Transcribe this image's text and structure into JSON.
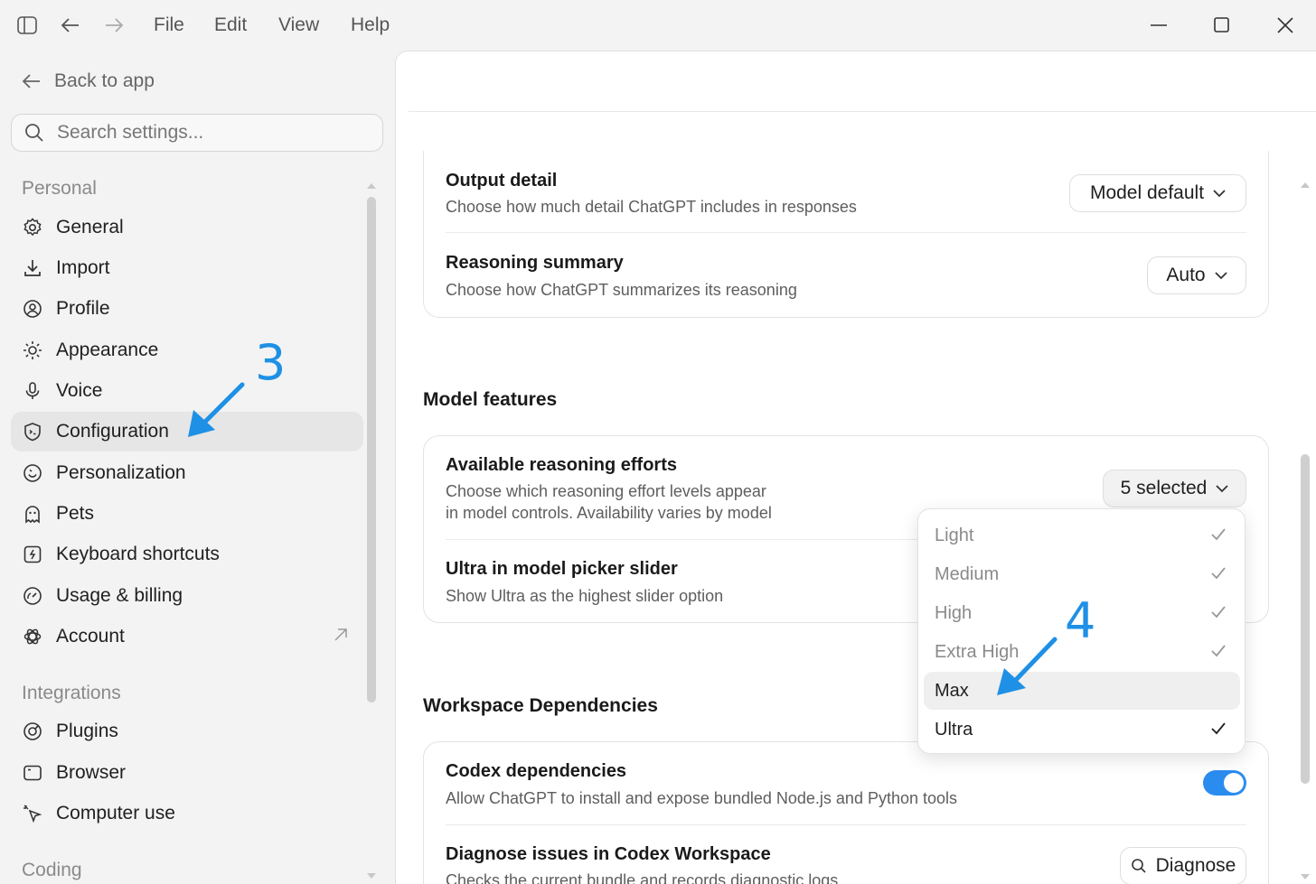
{
  "titlebar": {
    "menu": [
      "File",
      "Edit",
      "View",
      "Help"
    ]
  },
  "sidebar": {
    "back_label": "Back to app",
    "search_placeholder": "Search settings...",
    "personal_label": "Personal",
    "integrations_label": "Integrations",
    "coding_label": "Coding",
    "items": [
      {
        "label": "General",
        "icon": "gear-icon"
      },
      {
        "label": "Import",
        "icon": "download-icon"
      },
      {
        "label": "Profile",
        "icon": "user-circle-icon"
      },
      {
        "label": "Appearance",
        "icon": "sun-icon"
      },
      {
        "label": "Voice",
        "icon": "microphone-icon"
      },
      {
        "label": "Configuration",
        "icon": "shield-code-icon",
        "active": true
      },
      {
        "label": "Personalization",
        "icon": "smile-icon"
      },
      {
        "label": "Pets",
        "icon": "ghost-icon"
      },
      {
        "label": "Keyboard shortcuts",
        "icon": "keyboard-icon"
      },
      {
        "label": "Usage & billing",
        "icon": "gauge-icon"
      },
      {
        "label": "Account",
        "icon": "openai-icon"
      }
    ],
    "integration_items": [
      {
        "label": "Plugins",
        "icon": "plug-icon"
      },
      {
        "label": "Browser",
        "icon": "browser-icon"
      },
      {
        "label": "Computer use",
        "icon": "cursor-icon"
      }
    ]
  },
  "main": {
    "output_detail": {
      "title": "Output detail",
      "desc": "Choose how much detail ChatGPT includes in responses",
      "value": "Model default"
    },
    "reasoning_summary": {
      "title": "Reasoning summary",
      "desc": "Choose how ChatGPT summarizes its reasoning",
      "value": "Auto"
    },
    "model_features_heading": "Model features",
    "reasoning_efforts": {
      "title": "Available reasoning efforts",
      "desc_line1": "Choose which reasoning effort levels appear",
      "desc_line2": "in model controls. Availability varies by model",
      "value": "5 selected"
    },
    "ultra_slider": {
      "title": "Ultra in model picker slider",
      "desc": "Show Ultra as the highest slider option"
    },
    "workspace_heading": "Workspace Dependencies",
    "codex_deps": {
      "title": "Codex dependencies",
      "desc": "Allow ChatGPT to install and expose bundled Node.js and Python tools",
      "enabled": true
    },
    "diagnose": {
      "title": "Diagnose issues in Codex Workspace",
      "desc": "Checks the current bundle and records diagnostic logs",
      "button": "Diagnose"
    }
  },
  "dropdown": {
    "items": [
      {
        "label": "Light",
        "checked": true
      },
      {
        "label": "Medium",
        "checked": true
      },
      {
        "label": "High",
        "checked": true
      },
      {
        "label": "Extra High",
        "checked": true
      },
      {
        "label": "Max",
        "checked": false
      },
      {
        "label": "Ultra",
        "checked": true
      }
    ]
  },
  "annotations": {
    "step3": "3",
    "step4": "4"
  },
  "colors": {
    "accent": "#2b8cf0",
    "annotation": "#1e90e6"
  }
}
